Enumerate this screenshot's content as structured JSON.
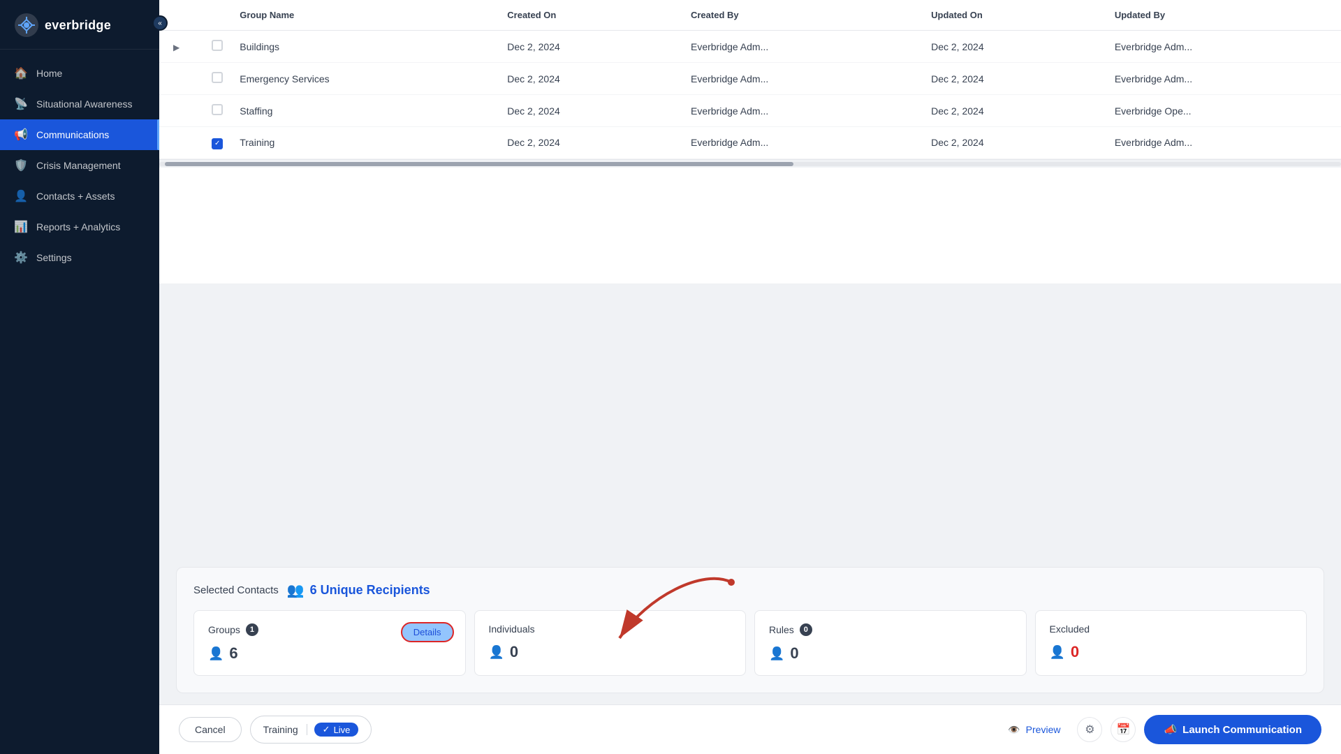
{
  "sidebar": {
    "logo_text": "everbridge",
    "collapse_label": "«",
    "nav_items": [
      {
        "id": "home",
        "label": "Home",
        "icon": "🏠",
        "active": false
      },
      {
        "id": "situational-awareness",
        "label": "Situational Awareness",
        "icon": "📡",
        "active": false
      },
      {
        "id": "communications",
        "label": "Communications",
        "icon": "📢",
        "active": true
      },
      {
        "id": "crisis-management",
        "label": "Crisis Management",
        "icon": "🛡️",
        "active": false
      },
      {
        "id": "contacts-assets",
        "label": "Contacts + Assets",
        "icon": "👤",
        "active": false
      },
      {
        "id": "reports-analytics",
        "label": "Reports + Analytics",
        "icon": "📊",
        "active": false
      },
      {
        "id": "settings",
        "label": "Settings",
        "icon": "⚙️",
        "active": false
      }
    ]
  },
  "table": {
    "columns": [
      "Group Name",
      "Created On",
      "Created By",
      "Updated On",
      "Updated By"
    ],
    "rows": [
      {
        "id": 1,
        "name": "Buildings",
        "created_on": "Dec 2, 2024",
        "created_by": "Everbridge Adm...",
        "updated_on": "Dec 2, 2024",
        "updated_by": "Everbridge Adm...",
        "checked": false,
        "expandable": true
      },
      {
        "id": 2,
        "name": "Emergency Services",
        "created_on": "Dec 2, 2024",
        "created_by": "Everbridge Adm...",
        "updated_on": "Dec 2, 2024",
        "updated_by": "Everbridge Adm...",
        "checked": false,
        "expandable": false
      },
      {
        "id": 3,
        "name": "Staffing",
        "created_on": "Dec 2, 2024",
        "created_by": "Everbridge Adm...",
        "updated_on": "Dec 2, 2024",
        "updated_by": "Everbridge Ope...",
        "checked": false,
        "expandable": false
      },
      {
        "id": 4,
        "name": "Training",
        "created_on": "Dec 2, 2024",
        "created_by": "Everbridge Adm...",
        "updated_on": "Dec 2, 2024",
        "updated_by": "Everbridge Adm...",
        "checked": true,
        "expandable": false
      }
    ]
  },
  "selected_contacts": {
    "title": "Selected Contacts",
    "recipients_count": "6 Unique Recipients",
    "cards": [
      {
        "id": "groups",
        "label": "Groups",
        "badge": "1",
        "count": "6",
        "has_details": true,
        "details_label": "Details",
        "red": false
      },
      {
        "id": "individuals",
        "label": "Individuals",
        "badge": null,
        "count": "0",
        "has_details": false,
        "red": false
      },
      {
        "id": "rules",
        "label": "Rules",
        "badge": "0",
        "count": "0",
        "has_details": false,
        "red": false
      },
      {
        "id": "excluded",
        "label": "Excluded",
        "badge": null,
        "count": "0",
        "has_details": false,
        "red": true
      }
    ]
  },
  "bottom_bar": {
    "cancel_label": "Cancel",
    "training_label": "Training",
    "live_label": "Live",
    "preview_label": "Preview",
    "launch_label": "Launch Communication"
  }
}
